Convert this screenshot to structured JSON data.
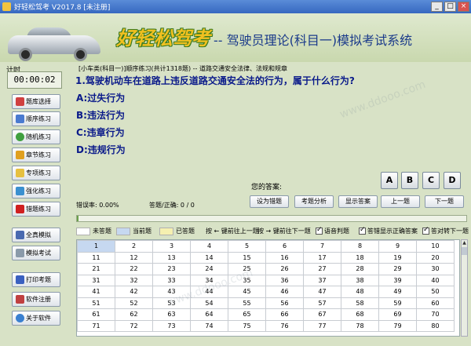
{
  "window": {
    "title": "好轻松驾考 V2017.8 [未注册]",
    "min": "_",
    "max": "□",
    "close": "×"
  },
  "banner": {
    "brand": "好轻松驾考",
    "subtitle": "-- 驾驶员理论(科目一)模拟考试系统"
  },
  "timer": {
    "label": "计时",
    "value": "00:00:02"
  },
  "nav": {
    "bank": "题库选择",
    "sequential": "顺序练习",
    "random": "随机练习",
    "chapter": "章节练习",
    "special": "专项练习",
    "strengthen": "强化练习",
    "wrong": "错题练习",
    "full_mock": "全真模拟",
    "mock_exam": "模拟考试",
    "print": "打印考题",
    "register": "软件注册",
    "about": "关于软件"
  },
  "question": {
    "breadcrumb": "[小车类(科目一)]顺序练习(共计1318题) -- 道路交通安全法律、法规和规章",
    "text": "1.驾驶机动车在道路上违反道路交通安全法的行为，属于什么行为?",
    "options": [
      "A:过失行为",
      "B:违法行为",
      "C:违章行为",
      "D:违规行为"
    ]
  },
  "answer": {
    "label": "您的答案:",
    "choices": [
      "A",
      "B",
      "C",
      "D"
    ]
  },
  "stats": {
    "error_rate": "错误率: 0.00%",
    "answered": "答题/正确: 0 / 0"
  },
  "actions": {
    "set_wrong": "设为错题",
    "analysis": "考题分析",
    "show_answer": "显示答案",
    "prev": "上一题",
    "next": "下一题"
  },
  "progress": 0.005,
  "legend": {
    "unanswered": "未答题",
    "current": "当前题",
    "answered": "已答题",
    "left_key": "按 ← 键前往上一题",
    "right_key": "按 → 键前往下一题",
    "voice": "语音判题",
    "show_correct": "答错显示正确答案",
    "auto_next": "答对转下一题"
  },
  "grid": {
    "rows": [
      [
        "1",
        "2",
        "3",
        "4",
        "5",
        "6",
        "7",
        "8",
        "9",
        "10"
      ],
      [
        "11",
        "12",
        "13",
        "14",
        "15",
        "16",
        "17",
        "18",
        "19",
        "20"
      ],
      [
        "21",
        "22",
        "23",
        "24",
        "25",
        "26",
        "27",
        "28",
        "29",
        "30"
      ],
      [
        "31",
        "32",
        "33",
        "34",
        "35",
        "36",
        "37",
        "38",
        "39",
        "40"
      ],
      [
        "41",
        "42",
        "43",
        "44",
        "45",
        "46",
        "47",
        "48",
        "49",
        "50"
      ],
      [
        "51",
        "52",
        "53",
        "54",
        "55",
        "56",
        "57",
        "58",
        "59",
        "60"
      ],
      [
        "61",
        "62",
        "63",
        "64",
        "65",
        "66",
        "67",
        "68",
        "69",
        "70"
      ],
      [
        "71",
        "72",
        "73",
        "74",
        "75",
        "76",
        "77",
        "78",
        "79",
        "80"
      ]
    ]
  },
  "colors": {
    "current": "#c6d8f0",
    "answered": "#f5f0b0",
    "unanswered": "#ffffff"
  },
  "watermark": "www.ddooo.com"
}
